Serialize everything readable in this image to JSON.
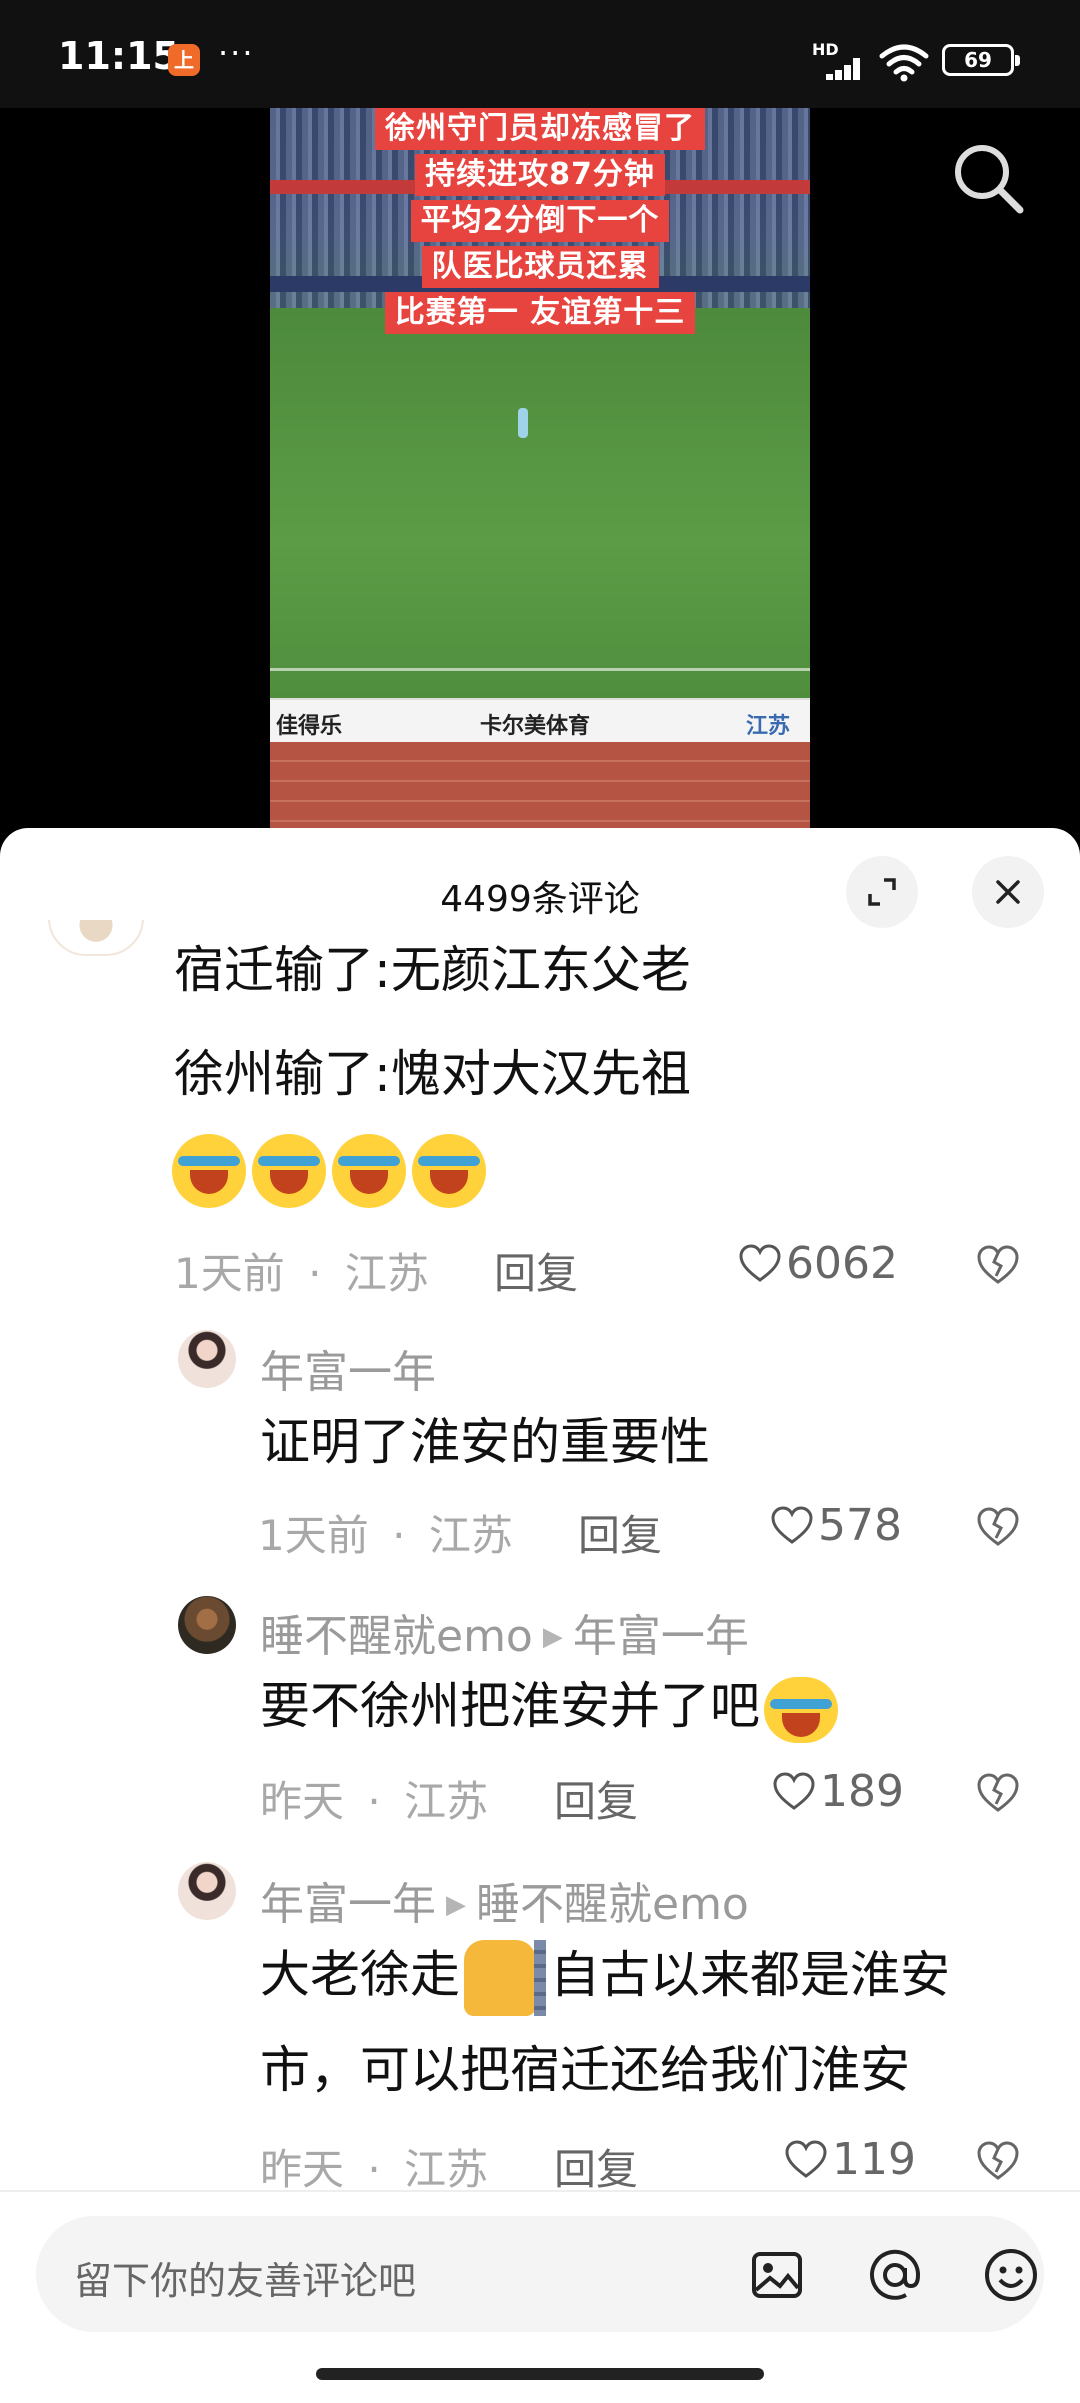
{
  "status_bar": {
    "time": "11:15",
    "app_icon_char": "上",
    "more": "···",
    "network": "HD",
    "battery": "69"
  },
  "video": {
    "captions": [
      "徐州守门员却冻感冒了",
      "持续进攻87分钟",
      "平均2分倒下一个",
      "队医比球员还累",
      "比赛第一 友谊第十三"
    ],
    "ads": [
      "佳得乐",
      "卡尔美体育",
      "江苏"
    ]
  },
  "comments_panel": {
    "title": "4499条评论",
    "comments": [
      {
        "lines": [
          "宿迁输了:无颜江东父老",
          "徐州输了:愧对大汉先祖"
        ],
        "time": "1天前",
        "location": "江苏",
        "reply_label": "回复",
        "likes": "6062"
      },
      {
        "author": "年富一年",
        "text": "证明了淮安的重要性",
        "time": "1天前",
        "location": "江苏",
        "reply_label": "回复",
        "likes": "578"
      },
      {
        "author": "睡不醒就emo",
        "reply_to": "年富一年",
        "text": "要不徐州把淮安并了吧",
        "time": "昨天",
        "location": "江苏",
        "reply_label": "回复",
        "likes": "189"
      },
      {
        "author": "年富一年",
        "reply_to": "睡不醒就emo",
        "text_part1": "大老徐走",
        "text_part2": "自古以来都是淮安",
        "text_line2": "市，可以把宿迁还给我们淮安",
        "time": "昨天",
        "location": "江苏",
        "reply_label": "回复",
        "likes": "119"
      }
    ],
    "meta_separator": "·"
  },
  "input_bar": {
    "placeholder": "留下你的友善评论吧"
  },
  "icons": [
    "search-icon",
    "expand-icon",
    "close-icon",
    "heart-icon",
    "dislike-icon",
    "image-icon",
    "at-icon",
    "emoji-icon"
  ]
}
